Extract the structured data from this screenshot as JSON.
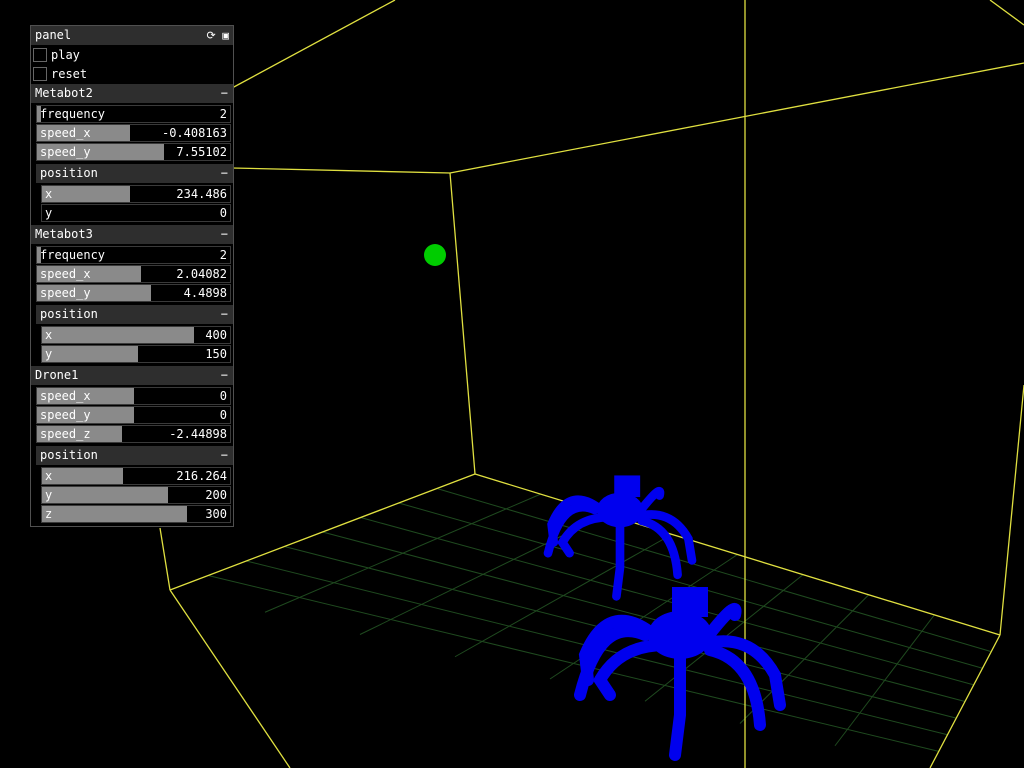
{
  "panel": {
    "title": "panel",
    "icons": [
      "refresh-icon",
      "save-icon"
    ],
    "toggles": [
      {
        "label": "play",
        "checked": false
      },
      {
        "label": "reset",
        "checked": false
      }
    ]
  },
  "groups": [
    {
      "name": "Metabot2",
      "sliders": [
        {
          "label": "frequency",
          "value": "2",
          "fraction": 0.02
        },
        {
          "label": "speed_x",
          "value": "-0.408163",
          "fraction": 0.48
        },
        {
          "label": "speed_y",
          "value": "7.55102",
          "fraction": 0.66
        }
      ],
      "position": {
        "title": "position",
        "sliders": [
          {
            "label": "x",
            "value": "234.486",
            "fraction": 0.47
          },
          {
            "label": "y",
            "value": "0",
            "fraction": 0.0
          }
        ]
      }
    },
    {
      "name": "Metabot3",
      "sliders": [
        {
          "label": "frequency",
          "value": "2",
          "fraction": 0.02
        },
        {
          "label": "speed_x",
          "value": "2.04082",
          "fraction": 0.54
        },
        {
          "label": "speed_y",
          "value": "4.4898",
          "fraction": 0.59
        }
      ],
      "position": {
        "title": "position",
        "sliders": [
          {
            "label": "x",
            "value": "400",
            "fraction": 0.81
          },
          {
            "label": "y",
            "value": "150",
            "fraction": 0.51
          }
        ]
      }
    },
    {
      "name": "Drone1",
      "sliders": [
        {
          "label": "speed_x",
          "value": "0",
          "fraction": 0.5
        },
        {
          "label": "speed_y",
          "value": "0",
          "fraction": 0.5
        },
        {
          "label": "speed_z",
          "value": "-2.44898",
          "fraction": 0.44
        }
      ],
      "position": {
        "title": "position",
        "sliders": [
          {
            "label": "x",
            "value": "216.264",
            "fraction": 0.43
          },
          {
            "label": "y",
            "value": "200",
            "fraction": 0.67
          },
          {
            "label": "z",
            "value": "300",
            "fraction": 0.77
          }
        ]
      }
    }
  ],
  "collapse_glyph": "−",
  "scene": {
    "wire_color": "#e0e040",
    "grid_color": "#1f4a1f",
    "ball_color": "#00cc00",
    "robot_color": "#0000ee"
  }
}
